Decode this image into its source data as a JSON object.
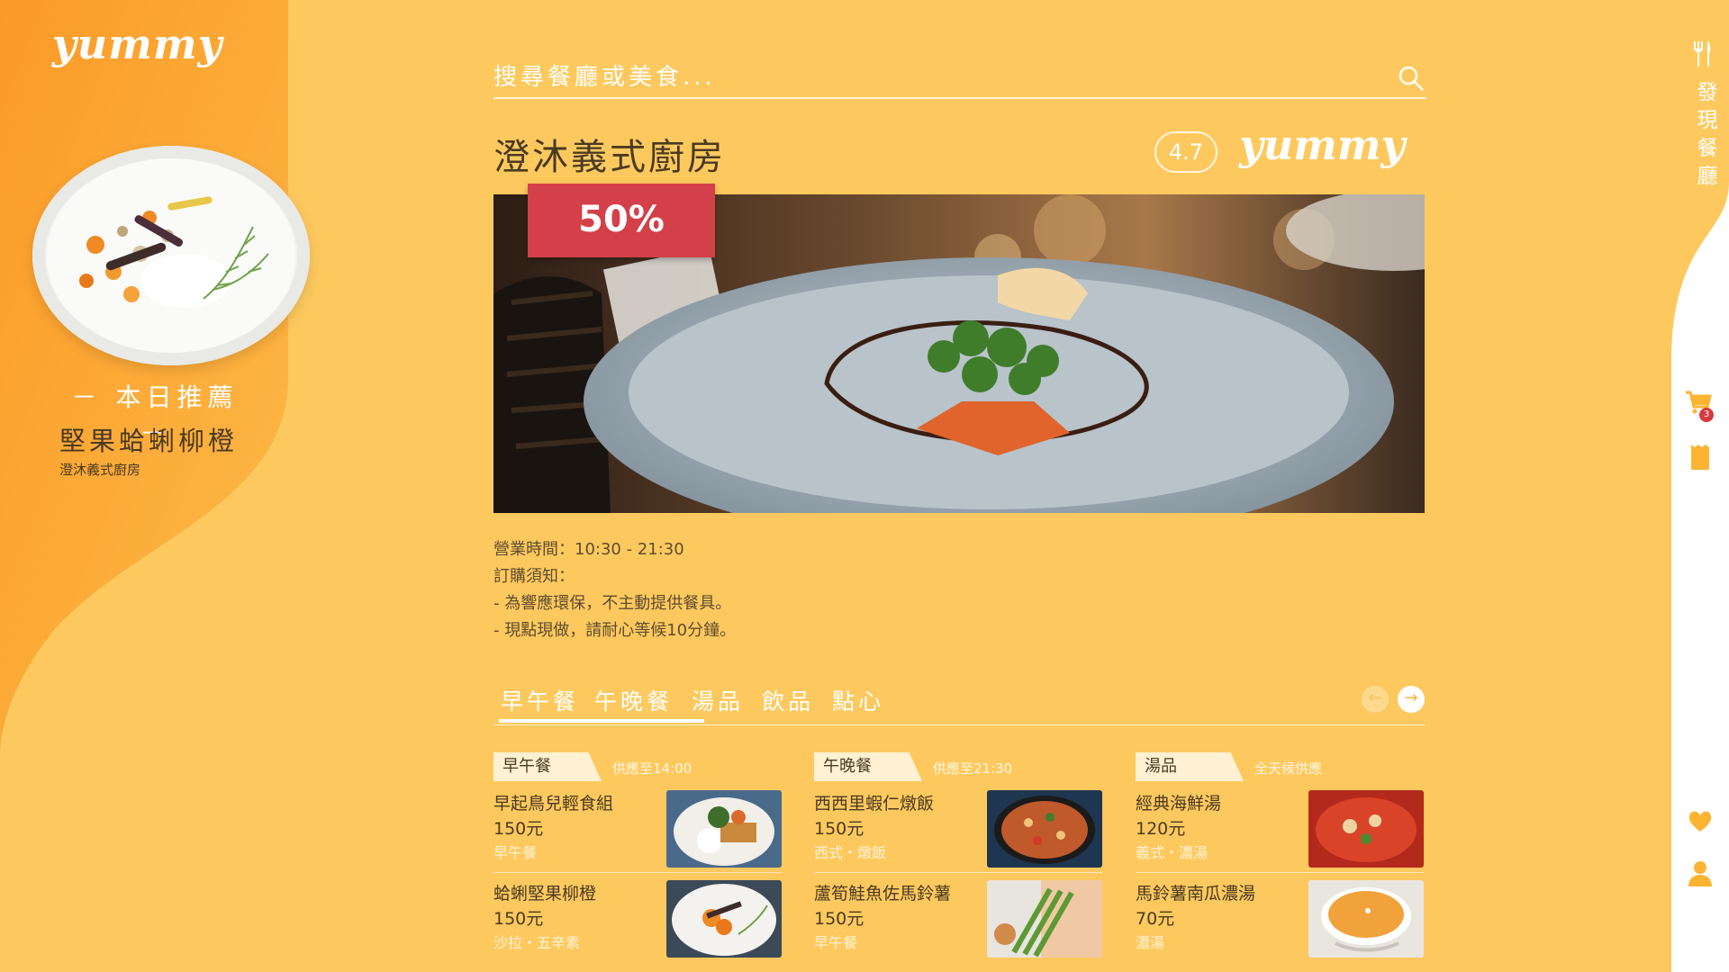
{
  "brand": {
    "logo": "yummy"
  },
  "recommend": {
    "title": "－ 本日推薦 －",
    "dish": "堅果蛤蜊柳橙",
    "restaurant": "澄沐義式廚房"
  },
  "search": {
    "placeholder": "搜尋餐廳或美食..."
  },
  "restaurant": {
    "name": "澄沐義式廚房",
    "rating": "4.7",
    "discount": "50%",
    "hours": "營業時間：10:30 - 21:30",
    "notice_title": "訂購須知：",
    "notices": [
      " - 為響應環保，不主動提供餐具。",
      " - 現點現做，請耐心等候10分鐘。"
    ]
  },
  "tabs": [
    "早午餐",
    "午晚餐",
    "湯品",
    "飲品",
    "點心"
  ],
  "side_nav": {
    "discover": "發現餐廳",
    "cart_count": "3"
  },
  "menu": {
    "columns": [
      {
        "tag": "早午餐",
        "sub": "供應至14:00",
        "items": [
          {
            "name": "早起鳥兒輕食組",
            "price": "150元",
            "category": "早午餐"
          },
          {
            "name": "蛤蜊堅果柳橙",
            "price": "150元",
            "category": "沙拉・五辛素"
          }
        ]
      },
      {
        "tag": "午晚餐",
        "sub": "供應至21:30",
        "items": [
          {
            "name": "西西里蝦仁燉飯",
            "price": "150元",
            "category": "西式・燉飯"
          },
          {
            "name": "蘆筍鮭魚佐馬鈴薯",
            "price": "150元",
            "category": "早午餐"
          }
        ]
      },
      {
        "tag": "湯品",
        "sub": "全天候供應",
        "items": [
          {
            "name": "經典海鮮湯",
            "price": "120元",
            "category": "義式・濃湯"
          },
          {
            "name": "馬鈴薯南瓜濃湯",
            "price": "70元",
            "category": "濃湯"
          }
        ]
      }
    ]
  },
  "colors": {
    "background": "#fdc95e",
    "sidebar_orange": "#fb9c2a",
    "accent_red": "#d44049",
    "white": "#ffffff"
  }
}
